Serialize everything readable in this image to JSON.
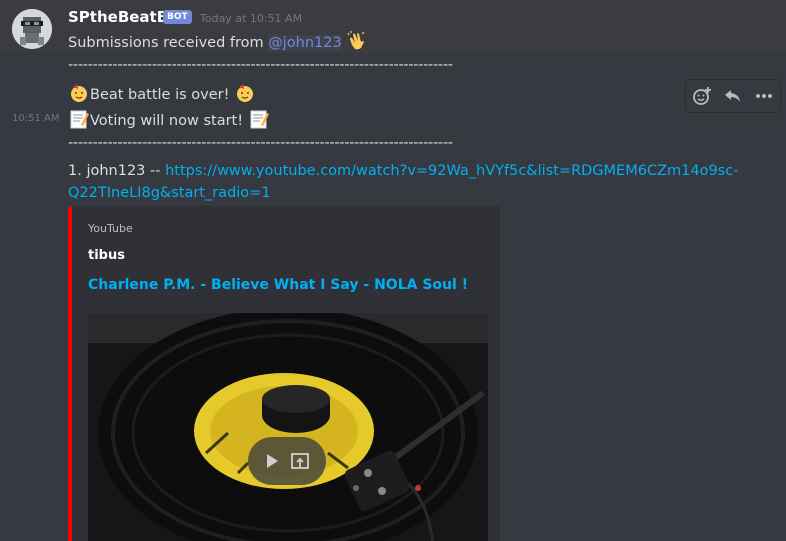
{
  "author": {
    "name": "SPtheBeatBot",
    "badge": "BOT",
    "timestamp": "Today at 10:51 AM"
  },
  "messages": {
    "line1_text": "Submissions received from ",
    "line1_mention": "@john123",
    "divider": "------------------------------------------------------------------------------",
    "beat_battle": "Beat battle is over!",
    "voting": "Voting will now start!",
    "side_time": "10:51 AM",
    "entry_prefix": "1. john123 -- ",
    "entry_url": "https://www.youtube.com/watch?v=92Wa_hVYf5c&list=RDGMEM6CZm14o9sc-Q22TIneLI8g&start_radio=1"
  },
  "embed": {
    "provider": "YouTube",
    "author": "tibus",
    "title": "Charlene P.M. -  Believe What I Say - NOLA Soul !",
    "accent_color": "#ff0000"
  },
  "icons": {
    "add_reaction": "add-reaction-icon",
    "reply": "reply-icon",
    "more": "more-icon",
    "clap": "clapping-hands-emoji",
    "party": "partying-face-emoji",
    "memo": "memo-emoji",
    "play": "play-icon",
    "external": "open-external-icon"
  }
}
